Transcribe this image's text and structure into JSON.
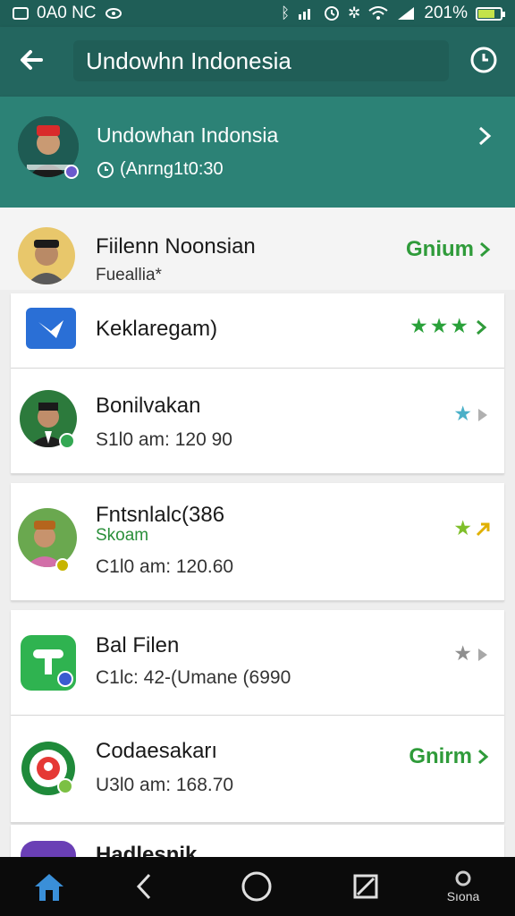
{
  "status_bar": {
    "left": "0A0 NC",
    "battery_text": "201%"
  },
  "app_bar": {
    "title": "Undowhn Indonesia"
  },
  "header": {
    "name": "Undowhan Indonsia",
    "subtitle": "(Anrng1t0:30"
  },
  "rows": [
    {
      "title": "Fiilenn Noonsian",
      "sub": "Fueallia*",
      "right_text": "Gnium",
      "right_color": "#2f9b3a"
    },
    {
      "title": "Keklaregam)",
      "stars": "★★★",
      "star_color": "#2aa13a"
    },
    {
      "title": "Bonilvakan",
      "sub": "S1l0 am: 120 90",
      "stars": "★",
      "star_color": "#4ab0c8"
    },
    {
      "title": "Fntsnlalc(386",
      "tag": "Skoam",
      "sub": "C1l0 am: 120.60",
      "stars": "★",
      "star_color": "#7fbf2a"
    },
    {
      "title": "Bal Filen",
      "sub": "C1lc: 42-(Umane (6990",
      "stars": "★",
      "star_color": "#8e8e8e"
    },
    {
      "title": "Codaesakarı",
      "sub": "U3l0 am: 168.70",
      "right_text": "Gnirm",
      "right_color": "#2f9b3a"
    },
    {
      "title": "Hadlesnik"
    }
  ],
  "navbar": {
    "right_label": "Sıona"
  },
  "colors": {
    "appbar": "#23665f",
    "header": "#2c8276",
    "accent_green": "#2f9b3a"
  }
}
